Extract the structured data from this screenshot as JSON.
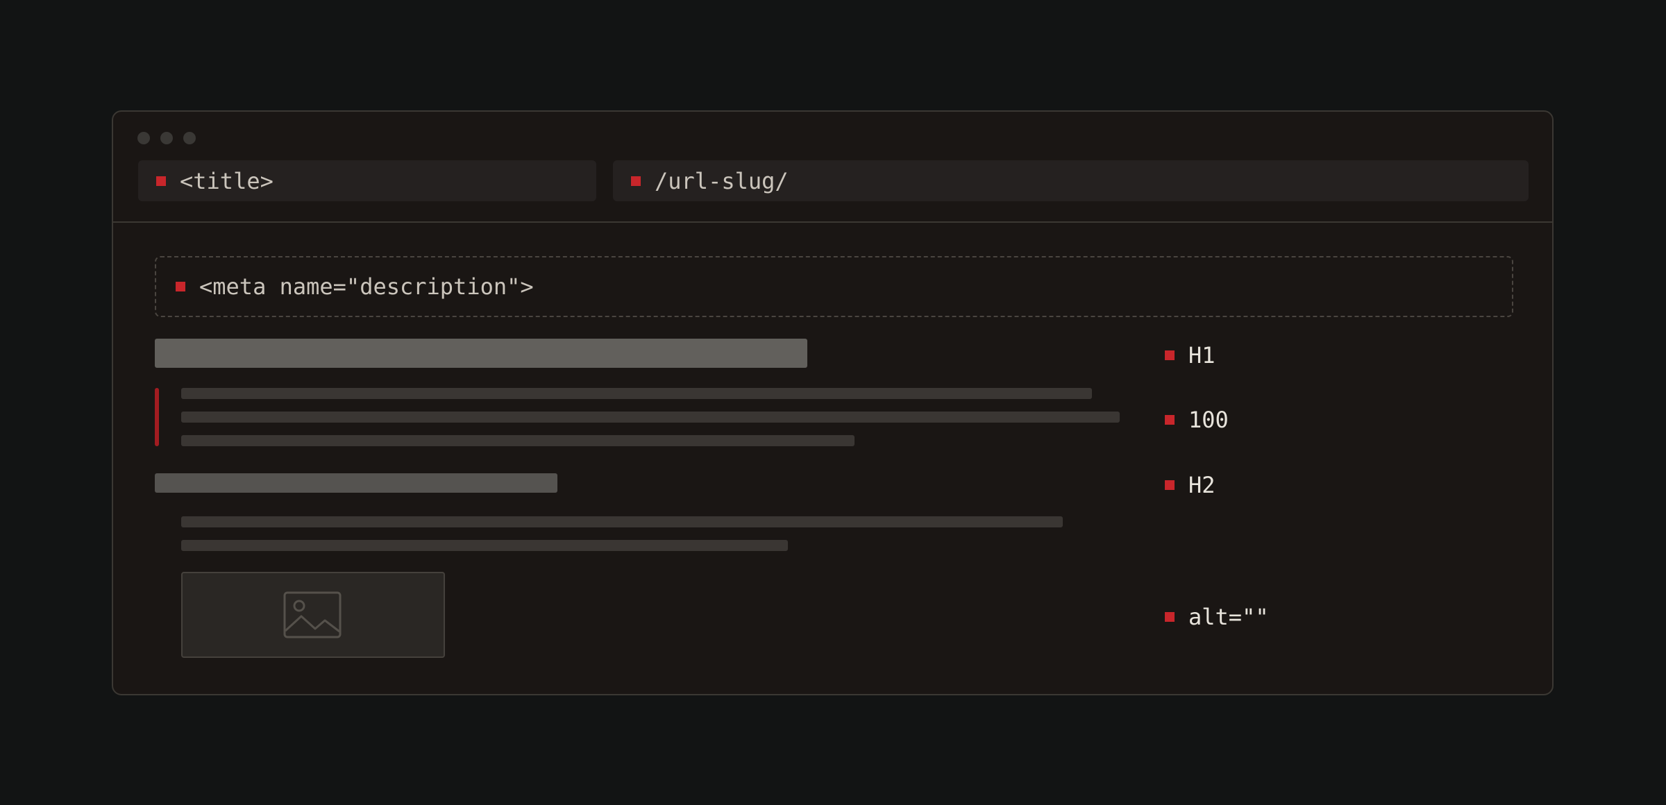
{
  "browser": {
    "title_field": "<title>",
    "url_field": "/url-slug/"
  },
  "page": {
    "meta_description": "<meta name=\"description\">"
  },
  "annotations": {
    "h1": "H1",
    "word_count": "100",
    "h2": "H2",
    "alt": "alt=\"\""
  },
  "colors": {
    "accent": "#c8262b",
    "background": "#121414",
    "window": "#1a1614"
  },
  "icons": {
    "image_placeholder": "image-icon",
    "marker": "square-marker"
  }
}
